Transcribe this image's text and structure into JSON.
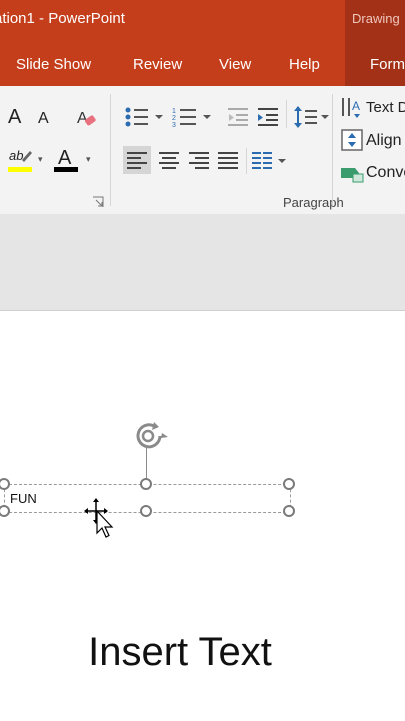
{
  "title_bar": {
    "title": "ation1  -  PowerPoint",
    "context_group": "Drawing"
  },
  "tabs": [
    {
      "label": "Slide Show"
    },
    {
      "label": "Review"
    },
    {
      "label": "View"
    },
    {
      "label": "Help"
    },
    {
      "label": "Form"
    }
  ],
  "ribbon": {
    "font_group": {
      "grow_label": "A",
      "shrink_label": "A",
      "highlight_label": "ab",
      "font_color_label": "A",
      "highlight_color": "#ffff00",
      "font_color": "#000000"
    },
    "paragraph_group": {
      "label": "Paragraph",
      "text_direction_label": "Text D",
      "align_text_label": "Align",
      "convert_label": "Conve"
    }
  },
  "slide": {
    "textbox_text": "FUN",
    "caption": "Insert Text"
  },
  "colors": {
    "accent": "#c43e1c",
    "context": "#a23118"
  }
}
